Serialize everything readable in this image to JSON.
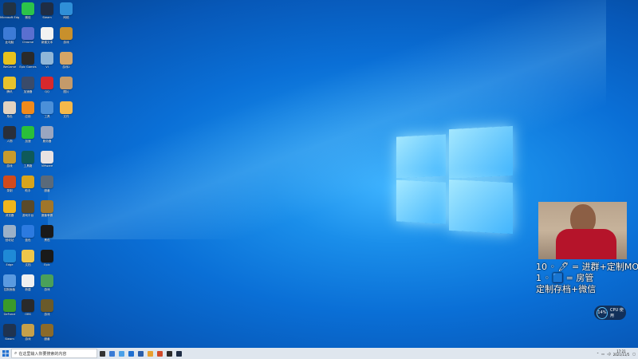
{
  "desktop": {
    "icons": [
      {
        "label": "Microsoft Edge",
        "color": "#223344"
      },
      {
        "label": "微信",
        "color": "#2cc44a"
      },
      {
        "label": "Steam",
        "color": "#1f2d45"
      },
      {
        "label": "网络",
        "color": "#2f8fd8"
      },
      {
        "label": "此电脑",
        "color": "#3d7bd6"
      },
      {
        "label": "Chrome",
        "color": "#5a6fd0"
      },
      {
        "label": "新建文本",
        "color": "#f2f2f2"
      },
      {
        "label": "游戏",
        "color": "#c8902c"
      },
      {
        "label": "WeGame",
        "color": "#e8c21c"
      },
      {
        "label": "Epic Games",
        "color": "#2a2a2a"
      },
      {
        "label": "VI",
        "color": "#8fb6d8"
      },
      {
        "label": "游戏2",
        "color": "#d5a566"
      },
      {
        "label": "腾讯",
        "color": "#e6c22c"
      },
      {
        "label": "加速器",
        "color": "#3a4b6a"
      },
      {
        "label": "QQ",
        "color": "#d8282c"
      },
      {
        "label": "图片",
        "color": "#c49a6a"
      },
      {
        "label": "角色",
        "color": "#e2d2c0"
      },
      {
        "label": "应用",
        "color": "#f08a1c"
      },
      {
        "label": "工具",
        "color": "#4b90d9"
      },
      {
        "label": "文件",
        "color": "#f4b84a"
      },
      {
        "label": "人物",
        "color": "#2a2f3a"
      },
      {
        "label": "加速",
        "color": "#2abf3a"
      },
      {
        "label": "服务器",
        "color": "#9aa6c0"
      },
      {
        "label": "",
        "color": "rgba(0,0,0,0)"
      },
      {
        "label": "游戏",
        "color": "#c89a2c"
      },
      {
        "label": "工具箱",
        "color": "#0e5a5a"
      },
      {
        "label": "VMware",
        "color": "#e8e2e2"
      },
      {
        "label": "",
        "color": "rgba(0,0,0,0)"
      },
      {
        "label": "录制",
        "color": "#d24a1c"
      },
      {
        "label": "助手",
        "color": "#d8a41c"
      },
      {
        "label": "魔兽",
        "color": "#5a6a7a"
      },
      {
        "label": "",
        "color": "rgba(0,0,0,0)"
      },
      {
        "label": "浏览器",
        "color": "#f0b51c"
      },
      {
        "label": "游戏平台",
        "color": "#5a4a2a"
      },
      {
        "label": "魔兽争霸",
        "color": "#a0762a"
      },
      {
        "label": "",
        "color": "rgba(0,0,0,0)"
      },
      {
        "label": "回收站",
        "color": "#9ab0c8"
      },
      {
        "label": "蓝色",
        "color": "#2c7ae0"
      },
      {
        "label": "黑色",
        "color": "#1a1a1a"
      },
      {
        "label": "",
        "color": "rgba(0,0,0,0)"
      },
      {
        "label": "Edge",
        "color": "#1f8ad6"
      },
      {
        "label": "文档",
        "color": "#f0c64a"
      },
      {
        "label": "Epic",
        "color": "#1a1a1a"
      },
      {
        "label": "",
        "color": "rgba(0,0,0,0)"
      },
      {
        "label": "控制面板",
        "color": "#5a9ae0"
      },
      {
        "label": "新建",
        "color": "#f0f0f0"
      },
      {
        "label": "游戏",
        "color": "#4aa05a"
      },
      {
        "label": "",
        "color": "rgba(0,0,0,0)"
      },
      {
        "label": "GeForce",
        "color": "#3a9a2a"
      },
      {
        "label": "OBS",
        "color": "#2a2a2a"
      },
      {
        "label": "游戏",
        "color": "#6a5a2a"
      },
      {
        "label": "",
        "color": "rgba(0,0,0,0)"
      },
      {
        "label": "Steam",
        "color": "#1f3350"
      },
      {
        "label": "游戏",
        "color": "#c6a04a"
      },
      {
        "label": "魔兽",
        "color": "#8a6a2a"
      },
      {
        "label": "",
        "color": "rgba(0,0,0,0)"
      }
    ]
  },
  "overlay": {
    "line1": "10 ◦ 🖊 = 进群+定制MOD",
    "line2": "1 ◦ 🟦 = 房管",
    "line3": "定制存档+微信"
  },
  "badge": {
    "percent": "14%",
    "text": "CPU 使用"
  },
  "taskbar": {
    "search_placeholder": "在这里输入你要搜索的内容",
    "apps": [
      "#333333",
      "#3a7bd5",
      "#4aa0e8",
      "#1f6fd0",
      "#2a5ea8",
      "#e8a030",
      "#d04a2a",
      "#2a2a2a",
      "#1f2d45"
    ],
    "time": "17:21",
    "date": "2021/11/5"
  }
}
